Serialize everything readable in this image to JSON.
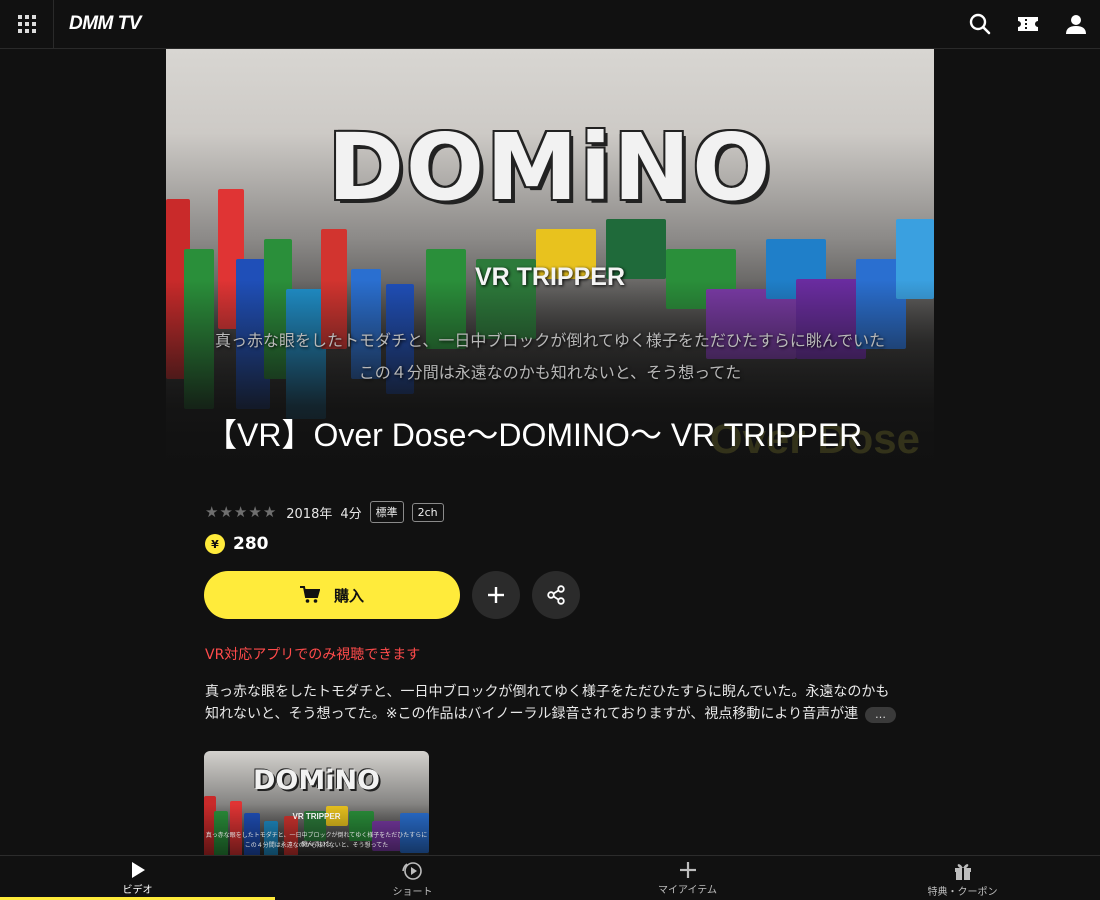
{
  "header": {
    "logo": "DMM TV",
    "icons": [
      "grid-menu-icon",
      "search-icon",
      "ticket-icon",
      "user-icon"
    ]
  },
  "hero": {
    "logo_text": "DOMiNO",
    "subtitle": "VR TRIPPER",
    "caption_line1": "真っ赤な眼をしたトモダチと、一日中ブロックが倒れてゆく様子をただひたすらに眺んでいた",
    "caption_line2": "この４分間は永遠なのかも知れないと、そう想ってた",
    "corner_text": "Over Dose"
  },
  "title": "【VR】Over Dose〜DOMINO〜 VR TRIPPER",
  "meta": {
    "rating_stars": 0,
    "year": "2018年",
    "duration": "4分",
    "quality_badge": "標準",
    "audio_badge": "2ch"
  },
  "price": {
    "coin_symbol": "¥",
    "value": "280"
  },
  "actions": {
    "buy_label": "購入"
  },
  "vr_note": "VR対応アプリでのみ視聴できます",
  "description": "真っ赤な眼をしたトモダチと、一日中ブロックが倒れてゆく様子をただひたすらに睨んでいた。永遠なのかも知れないと、そう想ってた。※この作品はバイノーラル録音されておりますが、視点移動により音声が連",
  "more_label": "…",
  "thumbnail": {
    "logo_text": "DOMiNO",
    "subtitle": "VR TRIPPER",
    "caption_line1": "真っ赤な眼をしたトモダチと、一日中ブロックが倒れてゆく様子をただひたすらに眺んでいた",
    "caption_line2": "この４分間は永遠なのかも知れないと、そう想ってた"
  },
  "bottom_nav": {
    "items": [
      {
        "label": "ビデオ",
        "icon": "play-icon",
        "active": true
      },
      {
        "label": "ショート",
        "icon": "shorts-icon",
        "active": false
      },
      {
        "label": "マイアイテム",
        "icon": "plus-icon",
        "active": false
      },
      {
        "label": "特典・クーポン",
        "icon": "gift-icon",
        "active": false
      }
    ]
  },
  "colors": {
    "accent": "#ffeb3b",
    "background": "#111111",
    "warning": "#ff4b4b"
  }
}
